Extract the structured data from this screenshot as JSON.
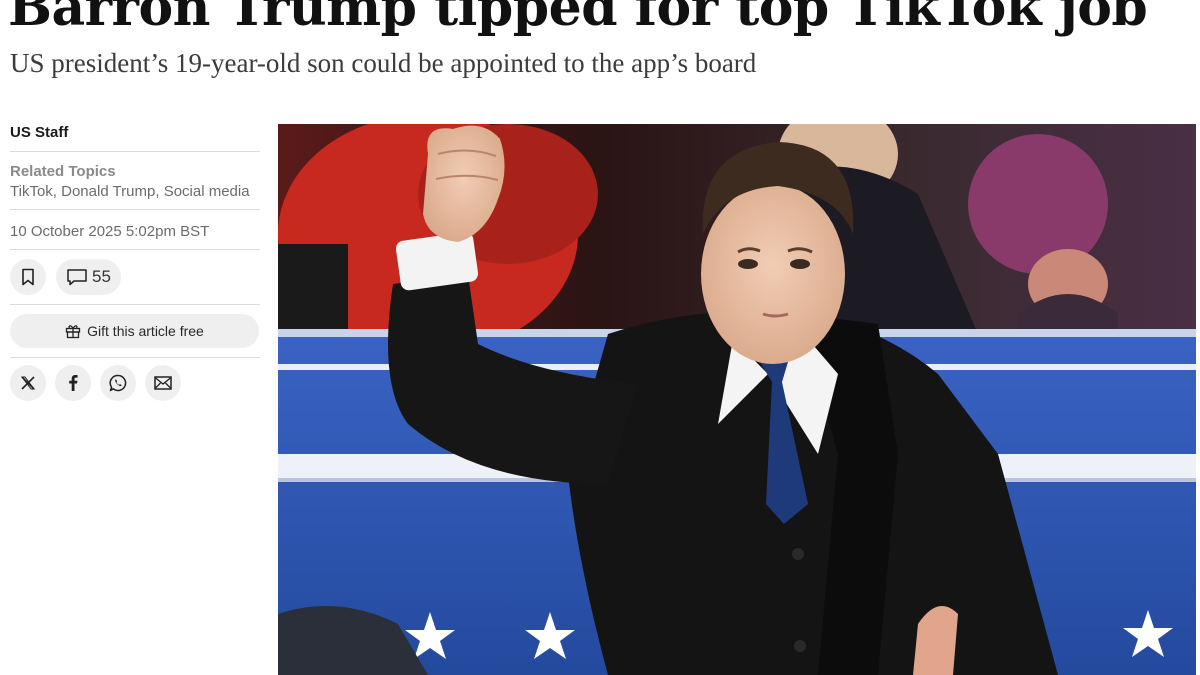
{
  "article": {
    "headline": "Barron Trump tipped for top TikTok job",
    "subheadline": "US president’s 19-year-old son could be appointed to the app’s board"
  },
  "meta": {
    "author": "US Staff",
    "related_topics_label": "Related Topics",
    "related_topics": [
      "TikTok",
      "Donald Trump",
      "Social media"
    ],
    "topic_separator": ", ",
    "date": "10 October 2025 5:02pm BST"
  },
  "actions": {
    "comment_count": "55",
    "gift_label": "Gift this article free"
  },
  "share": {
    "icons": [
      "x-icon",
      "facebook-icon",
      "whatsapp-icon",
      "email-icon"
    ]
  },
  "colors": {
    "button_bg": "#efefef",
    "rule": "#dcdcdc",
    "photo_blue": "#2d4ea8"
  }
}
